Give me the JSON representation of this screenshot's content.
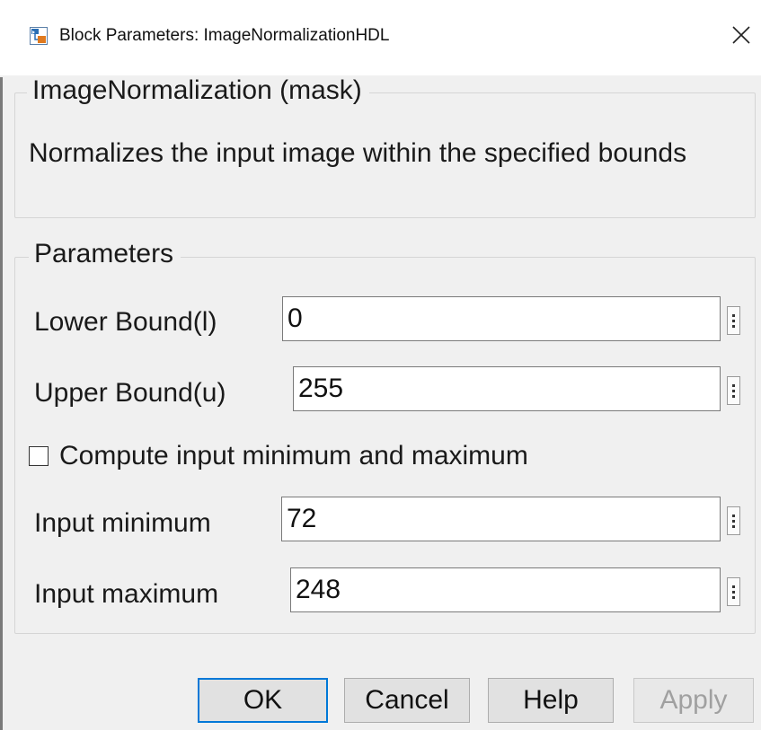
{
  "window": {
    "title": "Block Parameters: ImageNormalizationHDL",
    "close_glyph": "✕"
  },
  "mask_group": {
    "legend": "ImageNormalization (mask)",
    "description": "Normalizes the input image within the specified bounds"
  },
  "parameters_group": {
    "legend": "Parameters",
    "fields": [
      {
        "label": "Lower Bound(l)",
        "value": "0"
      },
      {
        "label": "Upper Bound(u)",
        "value": "255"
      },
      {
        "label": "Input minimum",
        "value": "72"
      },
      {
        "label": "Input maximum",
        "value": "248"
      }
    ],
    "compute_checkbox": {
      "label": "Compute input minimum and maximum",
      "checked": false
    }
  },
  "buttons": {
    "ok": "OK",
    "cancel": "Cancel",
    "help": "Help",
    "apply": "Apply"
  },
  "colors": {
    "background": "#f0f0f0",
    "focus_border": "#0078d7",
    "disabled_text": "#a0a0a0"
  },
  "icons": {
    "app": "simulink-block-icon",
    "close": "close-icon",
    "more": "more-options-icon"
  }
}
